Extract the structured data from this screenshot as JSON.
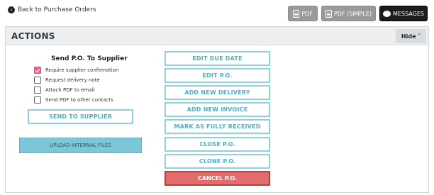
{
  "topbar": {
    "back_label": "Back to Purchase Orders",
    "buttons": {
      "pdf": "PDF",
      "pdf_simple": "PDF (SIMPLE)",
      "messages": "MESSAGES"
    }
  },
  "actions": {
    "title": "ACTIONS",
    "hide_label": "Hide",
    "send": {
      "title": "Send P.O. To Supplier",
      "options": [
        {
          "label": "Require supplier confirmation",
          "checked": true
        },
        {
          "label": "Request delivery note",
          "checked": false
        },
        {
          "label": "Attach PDF to email",
          "checked": false
        },
        {
          "label": "Send PDF to other contacts",
          "checked": false
        }
      ],
      "send_button": "SEND TO SUPPLIER",
      "upload_button": "UPLOAD INTERNAL FILES"
    },
    "buttons": [
      "EDIT DUE DATE",
      "EDIT P.O.",
      "ADD NEW DELIVERY",
      "ADD NEW INVOICE",
      "MARK AS FULLY RECEIVED",
      "CLOSE P.O.",
      "CLONE P.O.",
      "CANCEL P.O."
    ]
  },
  "colors": {
    "accent": "#49b2c8",
    "danger": "#e06c6c",
    "checked": "#e46a8a"
  },
  "icons": [
    "arrow-left-circle-icon",
    "pdf-icon",
    "message-bubble-icon",
    "chevron-up-icon",
    "checkmark-icon"
  ]
}
